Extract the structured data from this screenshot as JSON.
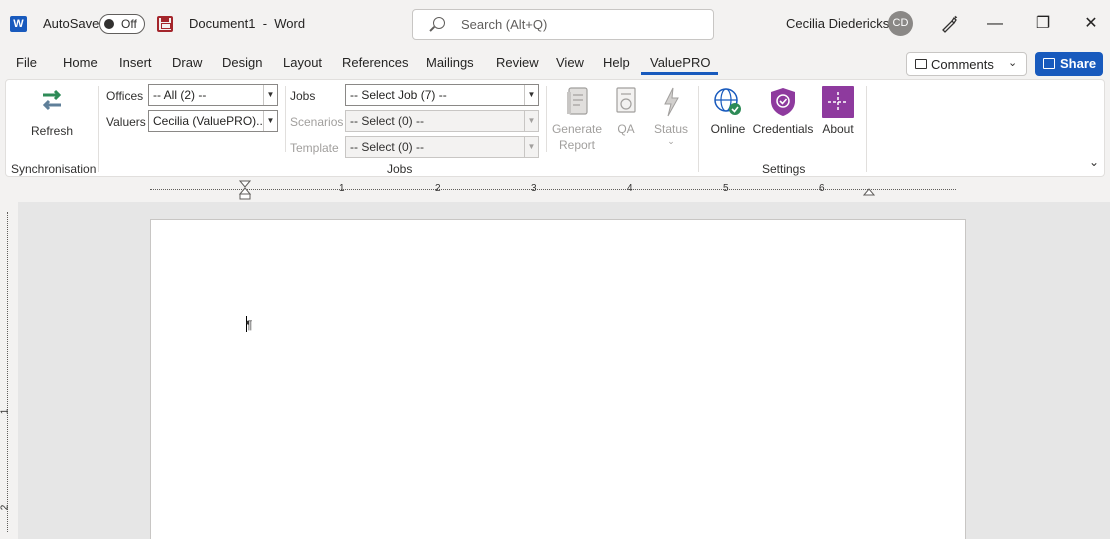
{
  "titlebar": {
    "app_icon": "word-icon",
    "app_letter": "W",
    "autosave_label": "AutoSave",
    "autosave_state": "Off",
    "document_title": "Document1  -  Word",
    "search_placeholder": "Search (Alt+Q)",
    "user_name": "Cecilia Diederick s",
    "user_initials": "CD"
  },
  "tabs": [
    {
      "label": "File"
    },
    {
      "label": "Home"
    },
    {
      "label": "Insert"
    },
    {
      "label": "Draw"
    },
    {
      "label": "Design"
    },
    {
      "label": "Layout"
    },
    {
      "label": "References"
    },
    {
      "label": "Mailings"
    },
    {
      "label": "Review"
    },
    {
      "label": "View"
    },
    {
      "label": "Help"
    },
    {
      "label": "ValuePRO",
      "active": true
    }
  ],
  "actions": {
    "comments_label": "Comments",
    "share_label": "Share"
  },
  "ribbon": {
    "sync": {
      "refresh_label": "Refresh",
      "group_label": "Synchronisation"
    },
    "jobs": {
      "offices_label": "Offices",
      "offices_value": "-- All (2) --",
      "valuers_label": "Valuers",
      "valuers_value": "Cecilia (ValuePRO)...",
      "jobs_label": "Jobs",
      "jobs_value": "-- Select Job (7) --",
      "scenarios_label": "Scenarios",
      "scenarios_value": "-- Select (0) --",
      "template_label": "Template",
      "template_value": "-- Select (0) --",
      "generate_label_1": "Generate",
      "generate_label_2": "Report",
      "qa_label": "QA",
      "status_label": "Status",
      "group_label": "Jobs"
    },
    "settings": {
      "online_label": "Online",
      "credentials_label": "Credentials",
      "about_label": "About",
      "group_label": "Settings"
    }
  },
  "ruler": {
    "h_numbers": [
      "1",
      "2",
      "3",
      "4",
      "5",
      "6"
    ],
    "v_numbers": [
      "1",
      "2"
    ]
  },
  "document": {
    "mark": "¶"
  },
  "colors": {
    "accent": "#185abd",
    "ribbon_bg": "#ffffff",
    "chrome_bg": "#f3f2f1"
  }
}
